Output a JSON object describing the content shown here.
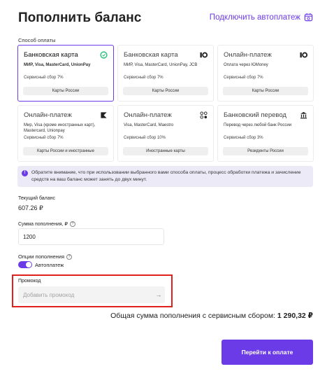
{
  "page_title": "Пополнить баланс",
  "autopay_link": "Подключить автоплатеж",
  "payment_section_label": "Способ оплаты",
  "payment_methods": [
    {
      "title": "Банковская карта",
      "sub": "МИР, Visa, MasterCard, UnionPay",
      "fee": "Сервисный сбор 7%",
      "tag": "Карты России",
      "icon": "green-circle-icon",
      "selected": true
    },
    {
      "title": "Банковская карта",
      "sub": "МИР, Visa, MasterCard, UnionPay, JCB",
      "fee": "Сервисный сбор 7%",
      "tag": "Карты России",
      "icon": "yoomoney-icon",
      "selected": false
    },
    {
      "title": "Онлайн-платеж",
      "sub": "Оплата через ЮMoney",
      "fee": "Сервисный сбор 7%",
      "tag": "Карты России",
      "icon": "yoomoney-icon",
      "selected": false
    },
    {
      "title": "Онлайн-платеж",
      "sub": "Мир, Visa (кроме иностранных карт), Mastercard, Unionpay",
      "fee": "Сервисный сбор 7%",
      "tag": "Карты России и иностранные",
      "icon": "flag-icon",
      "selected": false
    },
    {
      "title": "Онлайн-платеж",
      "sub": "Visa, MasterCard, Maestro",
      "fee": "Сервисный сбор 10%",
      "tag": "Иностранные карты",
      "icon": "grid-dots-icon",
      "selected": false
    },
    {
      "title": "Банковский перевод",
      "sub": "Перевод через любой банк России",
      "fee": "Сервисный сбор 3%",
      "tag": "Резиденты России",
      "icon": "bank-icon",
      "selected": false
    }
  ],
  "notice": "Обратите внимание, что при использовании выбранного вами способа оплаты, процесс обработки платежа и зачисление средств на ваш баланс может занять до двух минут.",
  "balance": {
    "label": "Текущий баланс",
    "value": "607.26 ₽"
  },
  "amount": {
    "label": "Сумма пополнения, ₽",
    "value": "1200"
  },
  "options": {
    "label": "Опции пополнения",
    "autopay_label": "Автоплатеж",
    "autopay_on": true
  },
  "promo": {
    "label": "Промокод",
    "placeholder": "Добавить промокод",
    "arrow": "→"
  },
  "total": {
    "label": "Общая сумма пополнения с сервисным сбором:",
    "value": "1 290,32 ₽"
  },
  "pay_button": "Перейти к оплате",
  "colors": {
    "accent": "#6c3be8",
    "highlight": "#e0201d",
    "notice_bg": "#eceaf7"
  }
}
